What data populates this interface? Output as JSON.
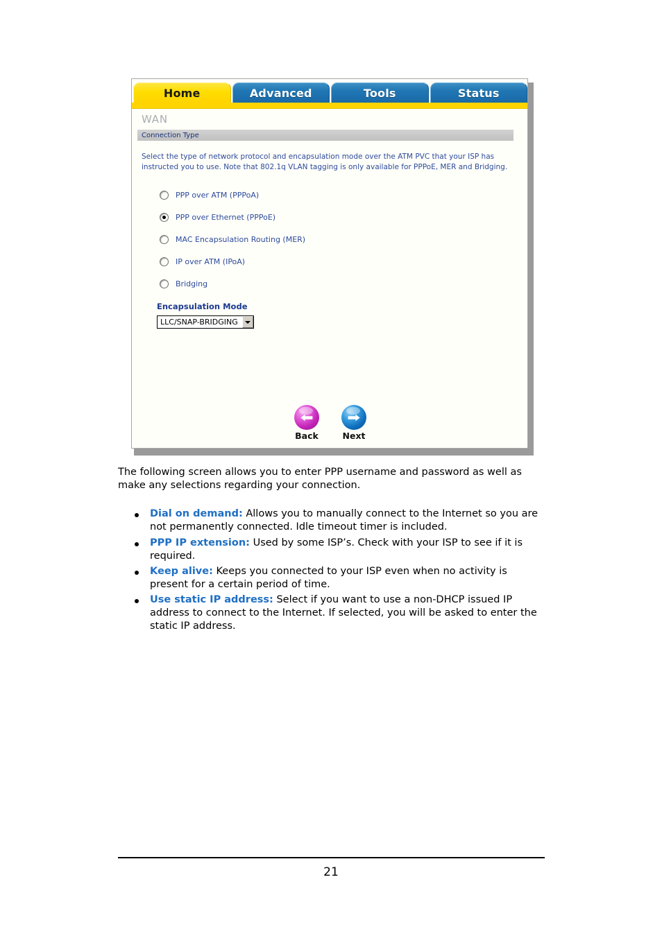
{
  "router_ui": {
    "tabs": [
      {
        "label": "Home",
        "active": true
      },
      {
        "label": "Advanced",
        "active": false
      },
      {
        "label": "Tools",
        "active": false
      },
      {
        "label": "Status",
        "active": false
      }
    ],
    "page_heading": "WAN",
    "section_title": "Connection Type",
    "instructions": "Select the type of network protocol and encapsulation mode over the ATM PVC that your ISP has instructed you to use. Note that 802.1q VLAN tagging is only available for PPPoE, MER and Bridging.",
    "connection_options": [
      {
        "label": "PPP over ATM (PPPoA)",
        "checked": false
      },
      {
        "label": "PPP over Ethernet (PPPoE)",
        "checked": true
      },
      {
        "label": "MAC Encapsulation Routing (MER)",
        "checked": false
      },
      {
        "label": "IP over ATM (IPoA)",
        "checked": false
      },
      {
        "label": "Bridging",
        "checked": false
      }
    ],
    "encapsulation": {
      "label": "Encapsulation Mode",
      "selected": "LLC/SNAP-BRIDGING"
    },
    "nav": {
      "back_label": "Back",
      "next_label": "Next"
    },
    "colors": {
      "active_tab": "#ffd400",
      "inactive_tab": "#2077b4",
      "link_blue": "#2c4a9a",
      "back_orb": "#c324b8",
      "next_orb": "#0f6fbd"
    }
  },
  "document": {
    "intro": "The following screen allows you to enter PPP username and password as well as make any selections regarding your connection.",
    "bullets": [
      {
        "term": "Dial on demand:",
        "text": " Allows you to manually connect to the Internet so you are not permanently connected. Idle timeout timer is included."
      },
      {
        "term": "PPP IP extension:",
        "text": " Used by some ISP’s. Check with your ISP to see if it is required."
      },
      {
        "term": "Keep alive:",
        "text": " Keeps you connected to your ISP even when no activity is present for a certain period of time."
      },
      {
        "term": "Use static IP address:",
        "text": " Select if you want to use a non-DHCP issued IP address to connect to the Internet. If selected, you will be asked to enter the static IP address."
      }
    ],
    "page_number": "21"
  }
}
